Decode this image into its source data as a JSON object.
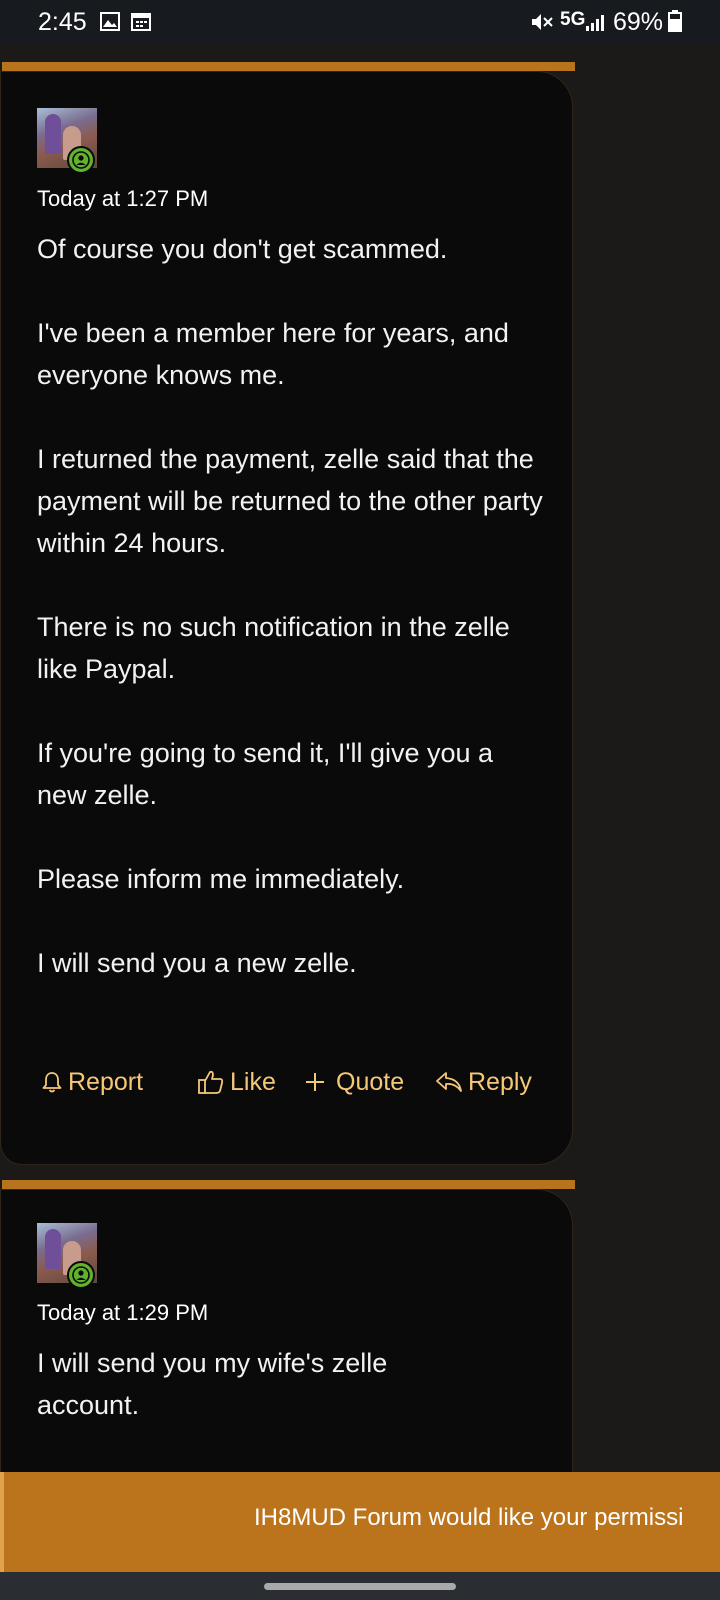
{
  "status_bar": {
    "time": "2:45",
    "network": "5G",
    "battery": "69%"
  },
  "posts": [
    {
      "timestamp": "Today at 1:27 PM",
      "paragraphs": [
        "Of course you don't get scammed.",
        "I've been a member here for years, and everyone knows me.",
        "I returned the payment, zelle said that the payment will be returned to the other party within 24 hours.",
        "There is no such notification in the zelle like Paypal.",
        "If you're going to send it, I'll give you a new zelle.",
        "Please inform me immediately.",
        "I will send you a new zelle."
      ],
      "actions": {
        "report": "Report",
        "like": "Like",
        "quote": "Quote",
        "reply": "Reply"
      }
    },
    {
      "timestamp": "Today at 1:29 PM",
      "paragraphs": [
        "I will send you my wife's zelle account."
      ]
    }
  ],
  "banner": {
    "text": "IH8MUD Forum would like your permissi"
  },
  "colors": {
    "accent": "#b8731d",
    "action_text": "#f5c878",
    "online": "#62b32c",
    "card_bg": "#0a0a0a"
  }
}
